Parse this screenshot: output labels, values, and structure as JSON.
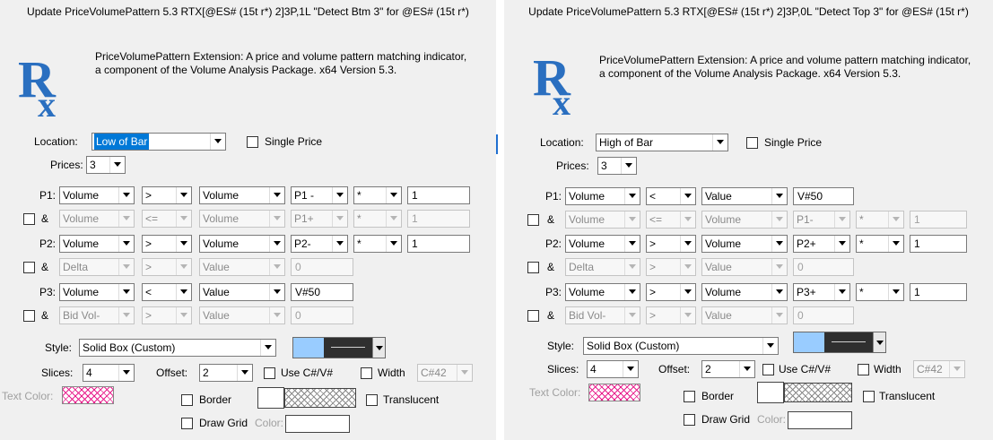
{
  "colors": {
    "logo_blue": "#2a6fc0",
    "selection": "#0078d7",
    "line_color_left": "#99ccff",
    "line_color_right": "#2f2f2f",
    "text_color": "#e81c8c"
  },
  "panels": [
    {
      "title": "Update PriceVolumePattern 5.3 RTX[@ES# (15t r*) 2]3P,1L \"Detect Btm 3\" for @ES# (15t r*)",
      "logo": "Rx",
      "description": "PriceVolumePattern Extension: A price and volume pattern matching indicator, a component of the Volume Analysis Package. x64 Version 5.3.",
      "location_label": "Location:",
      "location_value": "Low of Bar",
      "single_price_label": "Single Price",
      "prices_label": "Prices:",
      "prices_value": "3",
      "p1_label": "P1:",
      "p2_label": "P2:",
      "p3_label": "P3:",
      "and_label": "&",
      "p1": [
        "Volume",
        ">",
        "Volume",
        "P1 -",
        "*",
        "1"
      ],
      "p1_and": [
        "Volume",
        "<=",
        "Volume",
        "P1+",
        "*",
        "1"
      ],
      "p2": [
        "Volume",
        ">",
        "Volume",
        "P2-",
        "*",
        "1"
      ],
      "p2_and": [
        "Delta",
        ">",
        "Value",
        "0"
      ],
      "p3": [
        "Volume",
        "<",
        "Value",
        "V#50"
      ],
      "p3_and": [
        "Bid Vol-",
        ">",
        "Value",
        "0"
      ],
      "style_label": "Style:",
      "style_value": "Solid Box (Custom)",
      "slices_label": "Slices:",
      "slices_value": "4",
      "offset_label": "Offset:",
      "offset_value": "2",
      "use_cv_label": "Use C#/V#",
      "width_label": "Width",
      "width_value": "C#42",
      "text_color_label": "Text Color:",
      "border_label": "Border",
      "translucent_label": "Translucent",
      "draw_grid_label": "Draw Grid",
      "color_label": "Color:"
    },
    {
      "title": "Update PriceVolumePattern 5.3 RTX[@ES# (15t r*) 2]3P,0L \"Detect Top 3\" for @ES# (15t r*)",
      "logo": "Rx",
      "description": "PriceVolumePattern Extension: A price and volume pattern matching indicator, a component of the Volume Analysis Package. x64 Version 5.3.",
      "location_label": "Location:",
      "location_value": "High of Bar",
      "single_price_label": "Single Price",
      "prices_label": "Prices:",
      "prices_value": "3",
      "p1_label": "P1:",
      "p2_label": "P2:",
      "p3_label": "P3:",
      "and_label": "&",
      "p1": [
        "Volume",
        "<",
        "Value",
        "V#50"
      ],
      "p1_and": [
        "Volume",
        "<=",
        "Volume",
        "P1-",
        "*",
        "1"
      ],
      "p2": [
        "Volume",
        ">",
        "Volume",
        "P2+",
        "*",
        "1"
      ],
      "p2_and": [
        "Delta",
        ">",
        "Value",
        "0"
      ],
      "p3": [
        "Volume",
        ">",
        "Volume",
        "P3+",
        "*",
        "1"
      ],
      "p3_and": [
        "Bid Vol-",
        ">",
        "Value",
        "0"
      ],
      "style_label": "Style:",
      "style_value": "Solid Box (Custom)",
      "slices_label": "Slices:",
      "slices_value": "4",
      "offset_label": "Offset:",
      "offset_value": "2",
      "use_cv_label": "Use C#/V#",
      "width_label": "Width",
      "width_value": "C#42",
      "text_color_label": "Text Color:",
      "border_label": "Border",
      "translucent_label": "Translucent",
      "draw_grid_label": "Draw Grid",
      "color_label": "Color:"
    }
  ]
}
